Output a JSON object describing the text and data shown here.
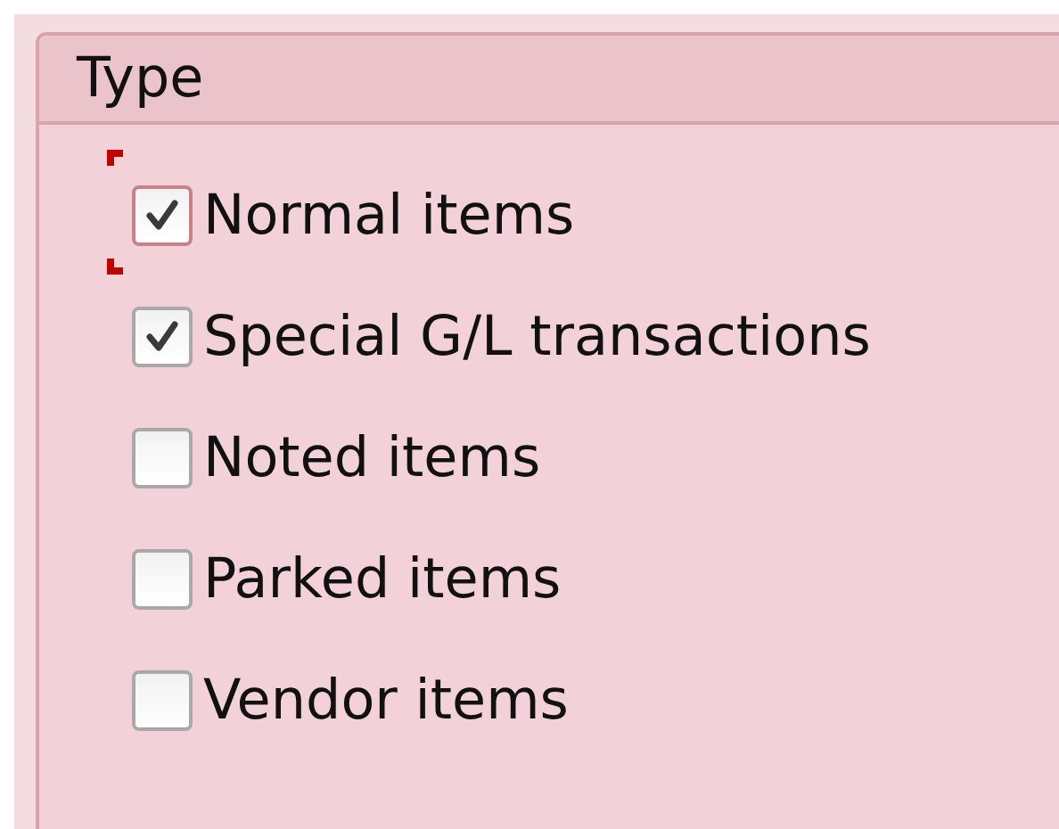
{
  "group": {
    "title": "Type",
    "items": [
      {
        "label": "Normal items",
        "checked": true,
        "focused": true
      },
      {
        "label": "Special G/L transactions",
        "checked": true,
        "focused": false
      },
      {
        "label": "Noted items",
        "checked": false,
        "focused": false
      },
      {
        "label": "Parked items",
        "checked": false,
        "focused": false
      },
      {
        "label": "Vendor items",
        "checked": false,
        "focused": false
      }
    ]
  }
}
